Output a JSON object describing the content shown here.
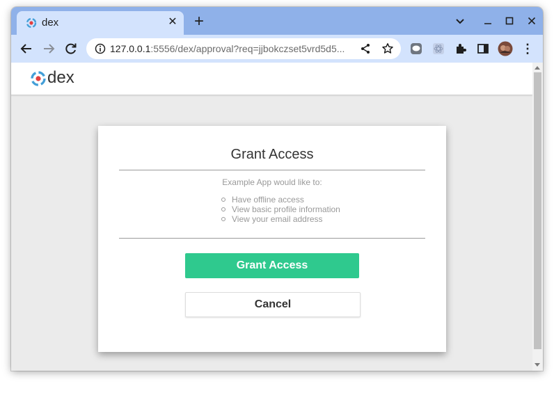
{
  "browser": {
    "tab": {
      "title": "dex",
      "close_glyph": "✕"
    },
    "new_tab_glyph": "+",
    "window_controls": {
      "dropdown": "⌄",
      "minimize": "–",
      "maximize": "☐",
      "close": "✕"
    },
    "nav": {
      "back": "←",
      "forward": "→",
      "reload": "↻"
    },
    "address": {
      "host": "127.0.0.1",
      "rest": ":5556/dex/approval?req=jjbokczset5vrd5d5..."
    },
    "toolbar_icons": [
      "line-extension-icon",
      "react-devtools-icon",
      "extensions-puzzle-icon",
      "side-panel-icon",
      "profile-avatar-icon",
      "more-menu-icon"
    ],
    "menu_glyph": "⋮",
    "accent": "#d3e3fd",
    "tabstrip_color": "#8fb1e9"
  },
  "app": {
    "logo_text": "dex",
    "logo_colors": [
      "#449fd8",
      "#e23f3f"
    ]
  },
  "approval": {
    "title": "Grant Access",
    "lead": "Example App would like to:",
    "scopes": [
      "Have offline access",
      "View basic profile information",
      "View your email address"
    ],
    "grant_label": "Grant Access",
    "cancel_label": "Cancel",
    "grant_color": "#2fc98e"
  }
}
